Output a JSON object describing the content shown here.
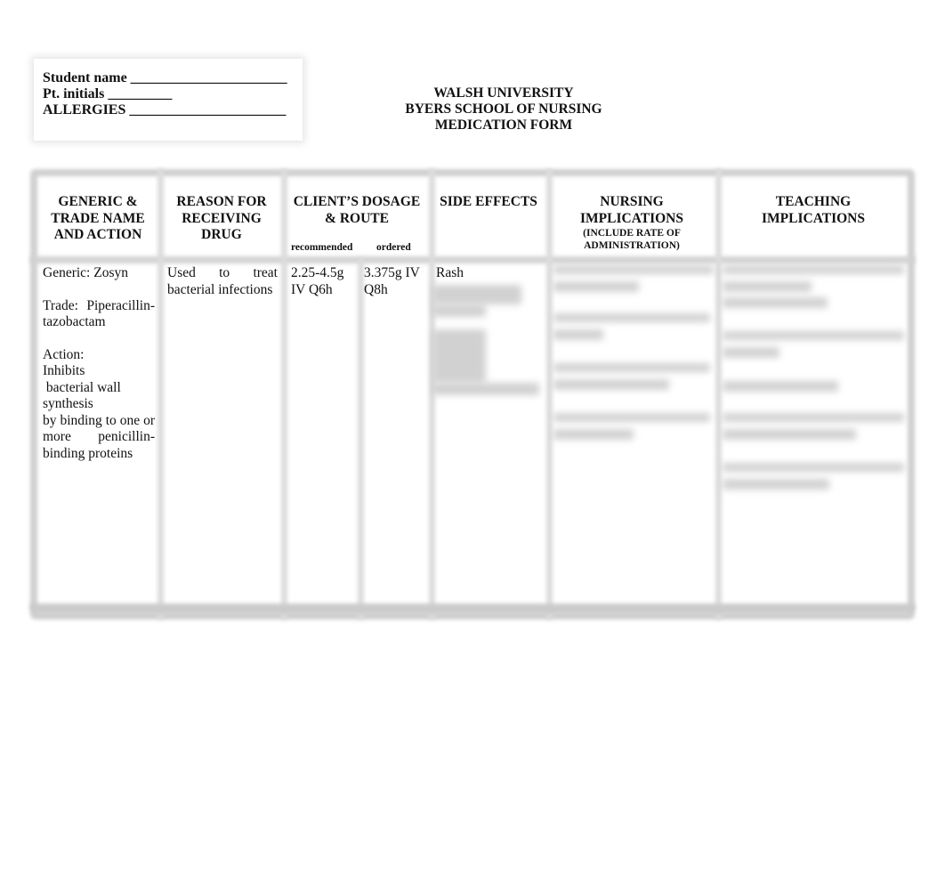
{
  "student_info": {
    "student_name_label": "Student name ______________________",
    "pt_initials_label": "Pt. initials _________",
    "allergies_label": "ALLERGIES ______________________"
  },
  "title": {
    "line1": "WALSH UNIVERSITY",
    "line2": "BYERS SCHOOL OF NURSING",
    "line3": "MEDICATION FORM"
  },
  "table": {
    "headers": {
      "generic": [
        "GENERIC &",
        "TRADE NAME",
        "AND ACTION"
      ],
      "reason": [
        "REASON FOR",
        "RECEIVING",
        "DRUG"
      ],
      "dosage": [
        "CLIENT’S DOSAGE",
        "& ROUTE"
      ],
      "dosage_recommended": "recommended",
      "dosage_ordered": "ordered",
      "side_effects": "SIDE EFFECTS",
      "nursing": [
        "NURSING",
        "IMPLICATIONS"
      ],
      "nursing_sub": [
        "(INCLUDE  RATE OF",
        "ADMINISTRATION)"
      ],
      "teaching": [
        "TEACHING",
        "IMPLICATIONS"
      ]
    },
    "row": {
      "generic": "Generic: Zosyn",
      "trade": "Trade: Piperacillin-tazobactam",
      "action_label": "Action:",
      "action_lines": [
        "Inhibits",
        " bacterial wall",
        "synthesis",
        "by binding to one or more penicillin-binding proteins"
      ],
      "reason": "Used to treat bacterial infections",
      "recommended": "2.25-4.5g IV Q6h",
      "ordered": "3.375g IV Q8h",
      "side_effects_visible": "Rash",
      "side_effects_blurred": true,
      "nursing_blurred": true,
      "teaching_blurred": true
    }
  }
}
